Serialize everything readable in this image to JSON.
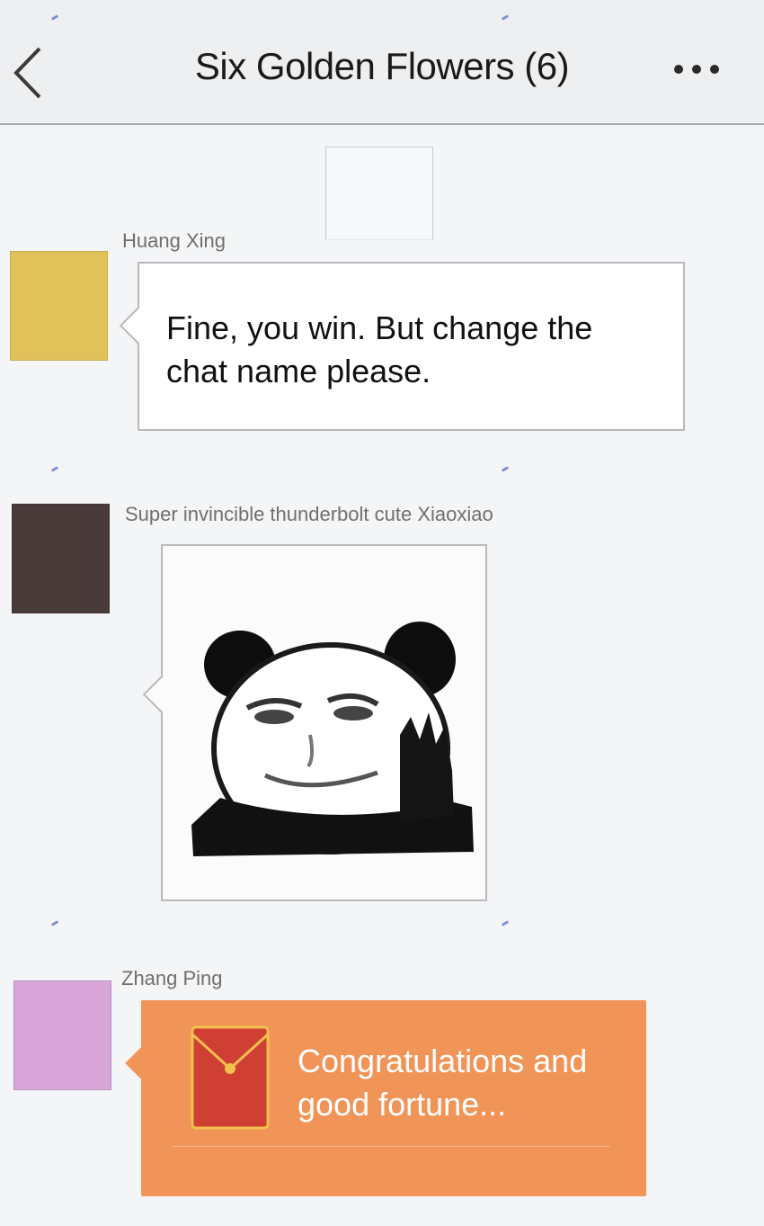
{
  "header": {
    "title": "Six Golden Flowers (6)",
    "back_icon": "chevron-left-icon",
    "more_icon": "more-dots-icon"
  },
  "messages": [
    {
      "sender": "Huang Xing",
      "avatar_color": "#e1c15a",
      "text": "Fine, you win. But change the chat name please."
    },
    {
      "sender": "Super invincible thunderbolt cute Xiaoxiao",
      "avatar_color": "#4a3b3b",
      "sticker": "panda-meme-sticker"
    },
    {
      "sender": "Zhang Ping",
      "avatar_color": "#d8a6d8",
      "red_packet": {
        "text": "Congratulations and good fortune...",
        "color": "#f19458",
        "icon": "red-envelope-icon"
      }
    }
  ]
}
